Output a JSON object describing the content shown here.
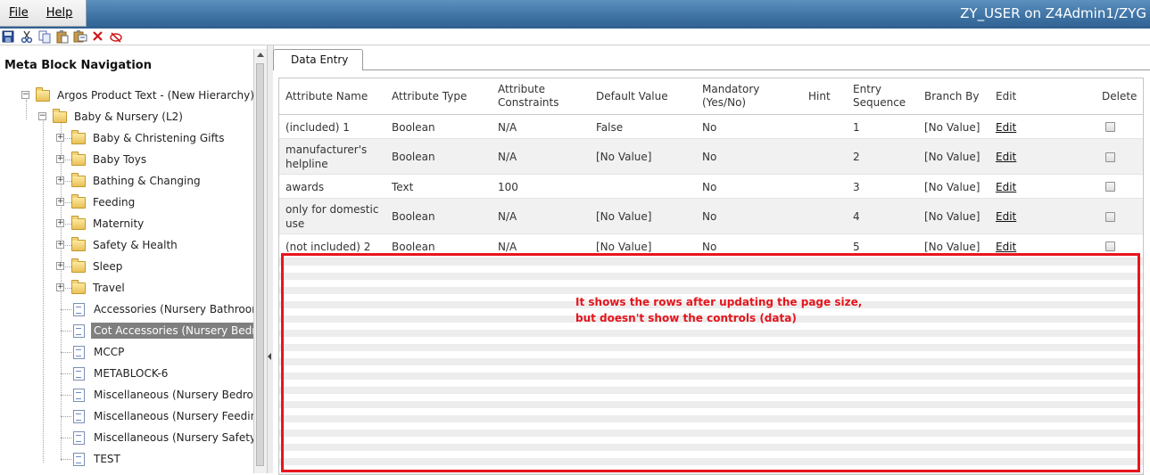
{
  "menu": {
    "file_label": "File",
    "help_label": "Help"
  },
  "window_title": "ZY_USER on Z4Admin1/ZYG",
  "toolbar": {
    "icons": [
      "save-icon",
      "cut-icon",
      "copy-icon",
      "paste-icon",
      "paste-special-icon",
      "delete-icon",
      "clear-icon"
    ]
  },
  "nav": {
    "title": "Meta Block Navigation",
    "root": "Argos Product Text - (New Hierarchy)",
    "level2": "Baby & Nursery (L2)",
    "folders": [
      "Baby & Christening Gifts",
      "Baby Toys",
      "Bathing & Changing",
      "Feeding",
      "Maternity",
      "Safety & Health",
      "Sleep",
      "Travel"
    ],
    "docs": [
      "Accessories (Nursery Bathroom)",
      "Cot Accessories (Nursery Bedroom)",
      "MCCP",
      "METABLOCK-6",
      "Miscellaneous (Nursery Bedroom)",
      "Miscellaneous (Nursery Feeding)",
      "Miscellaneous (Nursery Safety)",
      "TEST"
    ],
    "selected": "Cot Accessories (Nursery Bedroom)"
  },
  "tabs": {
    "active": "Data Entry"
  },
  "grid": {
    "headers": {
      "attribute_name": "Attribute Name",
      "attribute_type": "Attribute Type",
      "attribute_constraints_1": "Attribute",
      "attribute_constraints_2": "Constraints",
      "default_value": "Default Value",
      "mandatory_1": "Mandatory",
      "mandatory_2": "(Yes/No)",
      "hint": "Hint",
      "entry_sequence_1": "Entry",
      "entry_sequence_2": "Sequence",
      "branch_by": "Branch By",
      "edit": "Edit",
      "delete": "Delete"
    },
    "rows": [
      {
        "name": "(included) 1",
        "type": "Boolean",
        "constraints": "N/A",
        "default": "False",
        "mandatory": "No",
        "hint": "",
        "sequence": "1",
        "branch": "[No Value]",
        "edit": "Edit",
        "delete": false
      },
      {
        "name": "manufacturer's helpline",
        "type": "Boolean",
        "constraints": "N/A",
        "default": "[No Value]",
        "mandatory": "No",
        "hint": "",
        "sequence": "2",
        "branch": "[No Value]",
        "edit": "Edit",
        "delete": false
      },
      {
        "name": "awards",
        "type": "Text",
        "constraints": "100",
        "default": "",
        "mandatory": "No",
        "hint": "",
        "sequence": "3",
        "branch": "[No Value]",
        "edit": "Edit",
        "delete": false
      },
      {
        "name": "only for domestic use",
        "type": "Boolean",
        "constraints": "N/A",
        "default": "[No Value]",
        "mandatory": "No",
        "hint": "",
        "sequence": "4",
        "branch": "[No Value]",
        "edit": "Edit",
        "delete": false
      },
      {
        "name": "(not included) 2",
        "type": "Boolean",
        "constraints": "N/A",
        "default": "[No Value]",
        "mandatory": "No",
        "hint": "",
        "sequence": "5",
        "branch": "[No Value]",
        "edit": "Edit",
        "delete": false
      }
    ]
  },
  "annotation": {
    "line1": "It shows the rows after updating the page size,",
    "line2": "but doesn't show the controls (data)",
    "color": "#e8151d"
  }
}
